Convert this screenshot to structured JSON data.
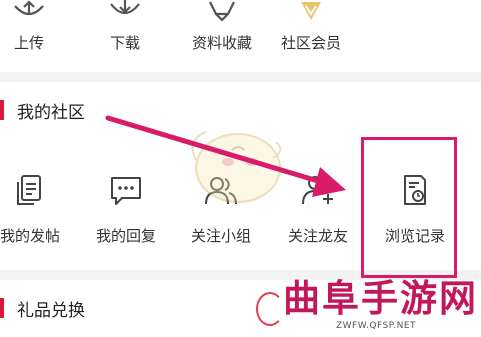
{
  "top_row": {
    "items": [
      {
        "label": "上传",
        "icon": "upload-cloud-icon"
      },
      {
        "label": "下载",
        "icon": "download-cloud-icon"
      },
      {
        "label": "资料收藏",
        "icon": "star-icon"
      },
      {
        "label": "社区会员",
        "icon": "vip-shield-icon"
      }
    ]
  },
  "community": {
    "title": "我的社区",
    "items": [
      {
        "label": "我的发帖",
        "icon": "document-post-icon"
      },
      {
        "label": "我的回复",
        "icon": "chat-reply-icon"
      },
      {
        "label": "关注小组",
        "icon": "group-people-icon"
      },
      {
        "label": "关注龙友",
        "icon": "add-friend-icon"
      },
      {
        "label": "浏览记录",
        "icon": "history-document-icon"
      }
    ]
  },
  "gifts": {
    "title": "礼品兑换"
  },
  "watermark": {
    "title": "曲阜手游网",
    "url": "ZWFW.QFSP.NET"
  },
  "colors": {
    "accent": "#d81b3a",
    "highlight": "#d81b6a",
    "watermark": "#c2185b"
  }
}
